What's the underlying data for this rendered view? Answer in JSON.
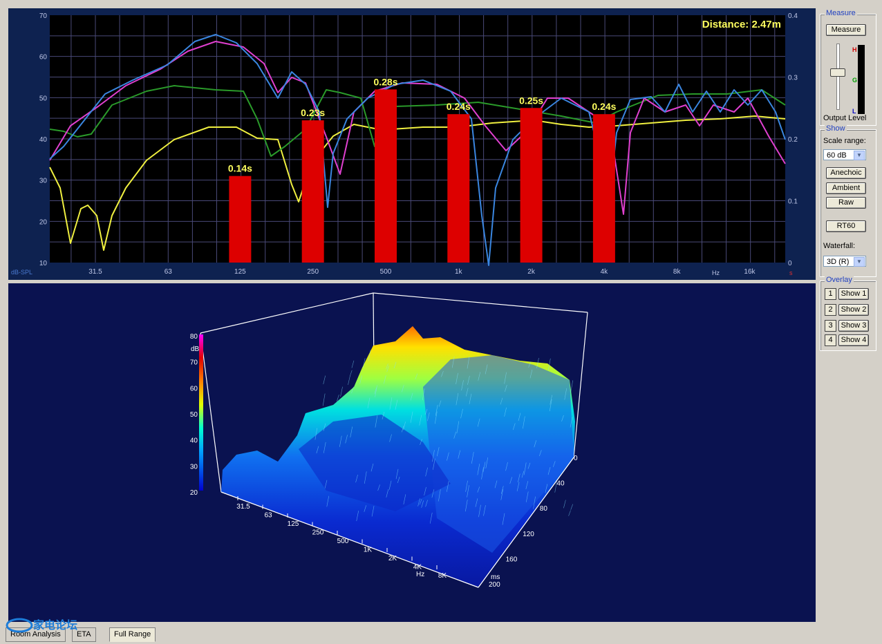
{
  "top_chart": {
    "distance_label": "Distance: 2.47m",
    "y_unit": "dB-SPL",
    "x_unit": "Hz",
    "right_unit": "s",
    "y_ticks": [
      "70",
      "60",
      "50",
      "40",
      "30",
      "20",
      "10"
    ],
    "right_ticks": [
      "0.4",
      "0.3",
      "0.2",
      "0.1",
      "0"
    ],
    "x_ticks": [
      "31.5",
      "63",
      "125",
      "250",
      "500",
      "1k",
      "2k",
      "4k",
      "8k",
      "16k"
    ],
    "bars": [
      {
        "label": "0.14s",
        "band": "125",
        "seconds": 0.14
      },
      {
        "label": "0.23s",
        "band": "250",
        "seconds": 0.23
      },
      {
        "label": "0.28s",
        "band": "500",
        "seconds": 0.28
      },
      {
        "label": "0.24s",
        "band": "1k",
        "seconds": 0.24
      },
      {
        "label": "0.25s",
        "band": "2k",
        "seconds": 0.25
      },
      {
        "label": "0.24s",
        "band": "4k",
        "seconds": 0.24
      }
    ],
    "colors": {
      "bar": "#dd0000",
      "bar_label": "#ffff60",
      "yellow": "#f0f040",
      "green": "#2a9a2a",
      "magenta": "#e040d0",
      "blue": "#3a86e0"
    }
  },
  "waterfall": {
    "z_unit": "dB",
    "z_ticks": [
      "80",
      "70",
      "60",
      "50",
      "40",
      "30",
      "20"
    ],
    "freq_unit": "Hz",
    "freq_ticks": [
      "31.5",
      "63",
      "125",
      "250",
      "500",
      "1K",
      "2K",
      "4K",
      "8K"
    ],
    "time_unit": "ms",
    "time_ticks": [
      "0",
      "40",
      "80",
      "120",
      "160",
      "200"
    ]
  },
  "sidebar": {
    "measure_group": "Measure",
    "measure_button": "Measure",
    "meter_high": "H",
    "meter_good": "G",
    "meter_low": "L",
    "output_level": "Output Level",
    "show_group": "Show",
    "scale_range_label": "Scale range:",
    "scale_range_value": "60 dB",
    "anechoic_button": "Anechoic",
    "ambient_button": "Ambient",
    "raw_button": "Raw",
    "rt60_button": "RT60",
    "waterfall_label": "Waterfall:",
    "waterfall_value": "3D (R)",
    "overlay_group": "Overlay",
    "overlays": [
      {
        "num": "1",
        "label": "Show 1"
      },
      {
        "num": "2",
        "label": "Show 2"
      },
      {
        "num": "3",
        "label": "Show 3"
      },
      {
        "num": "4",
        "label": "Show 4"
      }
    ]
  },
  "tabs": {
    "room_analysis": "Room Analysis",
    "eta": "ETA",
    "full_range": "Full Range",
    "watermark": "家电论坛"
  }
}
